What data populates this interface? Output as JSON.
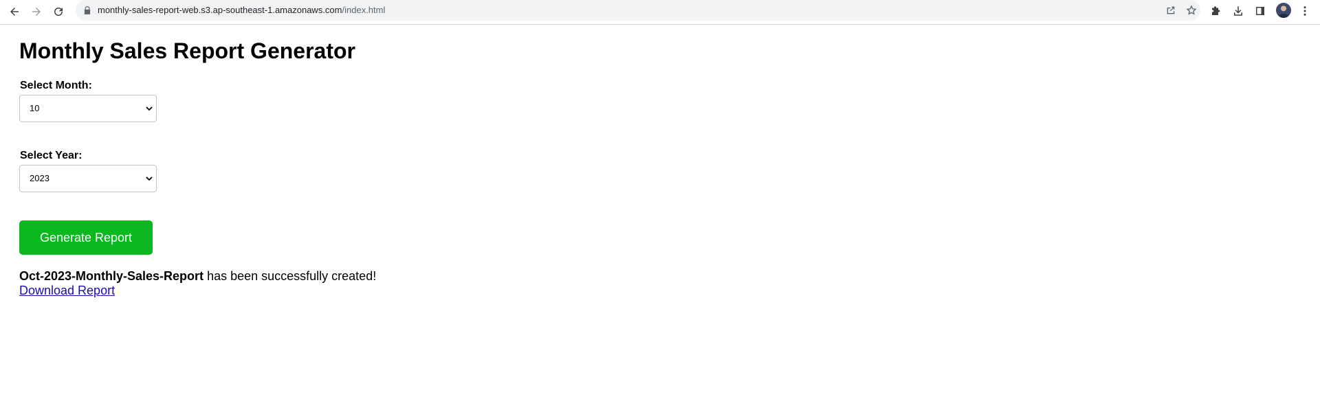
{
  "browser": {
    "url_host": "monthly-sales-report-web.s3.ap-southeast-1.amazonaws.com",
    "url_path": "/index.html",
    "icons": {
      "back": "back-arrow-icon",
      "forward": "forward-arrow-icon",
      "reload": "reload-icon",
      "lock": "lock-icon",
      "share": "share-icon",
      "bookmark": "star-icon",
      "extensions": "puzzle-icon",
      "download": "download-icon",
      "side_panel": "side-panel-icon",
      "profile": "avatar",
      "menu": "kebab-menu-icon"
    }
  },
  "page": {
    "title": "Monthly Sales Report Generator",
    "month": {
      "label": "Select Month:",
      "selected": "10"
    },
    "year": {
      "label": "Select Year:",
      "selected": "2023"
    },
    "generate_button": "Generate Report",
    "result": {
      "report_name": "Oct-2023-Monthly-Sales-Report",
      "message": " has been successfully created!",
      "download_link": "Download Report"
    },
    "colors": {
      "button": "#0bb81f",
      "link": "#1a0dab"
    }
  }
}
